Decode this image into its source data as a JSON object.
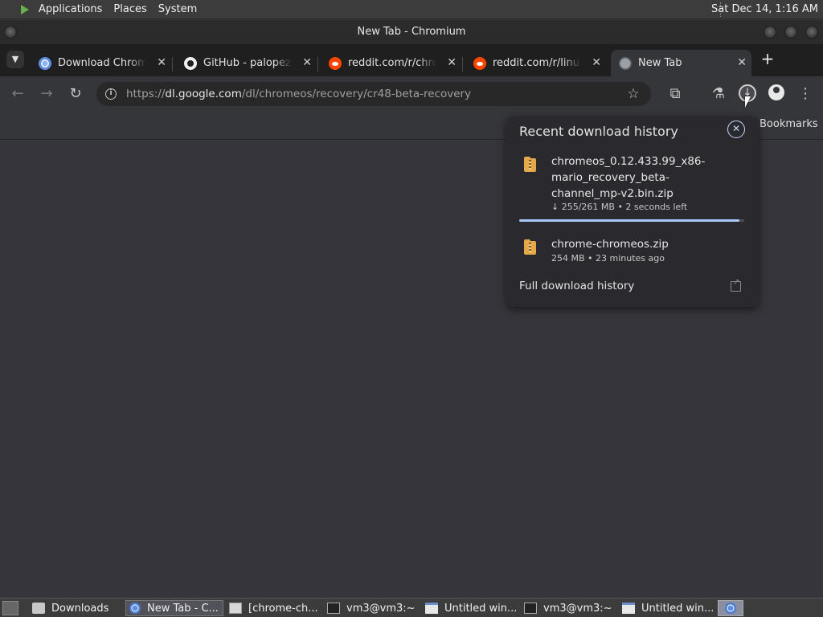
{
  "topbar": {
    "menu": [
      "Applications",
      "Places",
      "System"
    ],
    "clock": "Sat Dec 14,  1:16 AM"
  },
  "window": {
    "title": "New Tab - Chromium"
  },
  "tabs": [
    {
      "label": "Download Chromium",
      "icon": "chromium-icon",
      "active": false
    },
    {
      "label": "GitHub - palopezv/",
      "icon": "github-icon",
      "active": false
    },
    {
      "label": "reddit.com/r/chromeos",
      "icon": "reddit-icon",
      "active": false
    },
    {
      "label": "reddit.com/r/linux/",
      "icon": "reddit-icon",
      "active": false
    },
    {
      "label": "New Tab",
      "icon": "globe-icon",
      "active": true
    }
  ],
  "toolbar": {
    "url_prefix": "https://",
    "url_host": "dl.google.com",
    "url_path": "/dl/chromeos/recovery/cr48-beta-recovery"
  },
  "bookmarks": {
    "label": "Bookmarks"
  },
  "downloads_popup": {
    "title": "Recent download history",
    "items": [
      {
        "name": "chromeos_0.12.433.99_x86-mario_recovery_beta-channel_mp-v2.bin.zip",
        "status": "↓ 255/261 MB • 2 seconds left",
        "progress": 0.977
      },
      {
        "name": "chrome-chromeos.zip",
        "status": "254 MB • 23 minutes ago"
      }
    ],
    "full_history_label": "Full download history"
  },
  "taskbar": {
    "tasks": [
      {
        "label": "Downloads",
        "icon": "folder-icon",
        "active": false
      },
      {
        "label": "New Tab - C...",
        "icon": "chromium-icon",
        "active": true
      },
      {
        "label": "[chrome-ch...",
        "icon": "archive-icon",
        "active": false
      },
      {
        "label": "vm3@vm3:~",
        "icon": "terminal-icon",
        "active": false
      },
      {
        "label": "Untitled win...",
        "icon": "window-icon",
        "active": false
      },
      {
        "label": "vm3@vm3:~",
        "icon": "terminal-icon",
        "active": false
      },
      {
        "label": "Untitled win...",
        "icon": "window-icon",
        "active": false
      }
    ]
  }
}
